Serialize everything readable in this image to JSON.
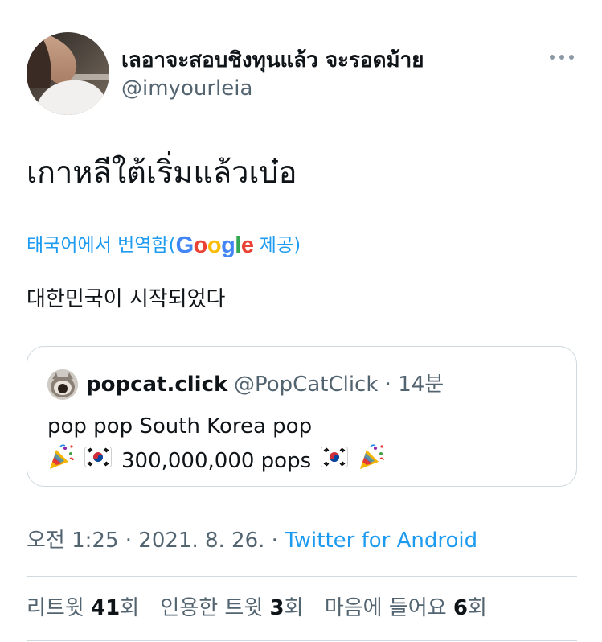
{
  "author": {
    "display_name": "เลอาจะสอบชิงทุนแล้ว จะรอดม้าย",
    "handle": "@imyourleia"
  },
  "tweet": {
    "text": "เกาหลีใต้เริ่มแล้วเบ๋อ",
    "translate_prefix": "태국어에서 번역함(",
    "translate_brand": "Google",
    "translate_suffix": " 제공)",
    "translated_text": "대한민국이 시작되었다"
  },
  "quote": {
    "name": "popcat.click",
    "meta": "@PopCatClick · 14분",
    "line1": "pop pop South Korea pop",
    "line2_count": "300,000,000 pops"
  },
  "meta": {
    "timestamp": "오전 1:25 · 2021. 8. 26. · ",
    "source": "Twitter for Android"
  },
  "stats": {
    "retweets_label": "리트윗 ",
    "retweets_count": "41",
    "retweets_unit": "회",
    "quotes_label": "인용한 트윗 ",
    "quotes_count": "3",
    "quotes_unit": "회",
    "likes_label": "마음에 들어요 ",
    "likes_count": "6",
    "likes_unit": "회"
  },
  "colors": {
    "link": "#1d9bf0",
    "secondary_text": "#536471",
    "border": "#cfd9de"
  },
  "icons": [
    "more-options-icon",
    "party-popper-icon",
    "south-korea-flag-icon"
  ]
}
